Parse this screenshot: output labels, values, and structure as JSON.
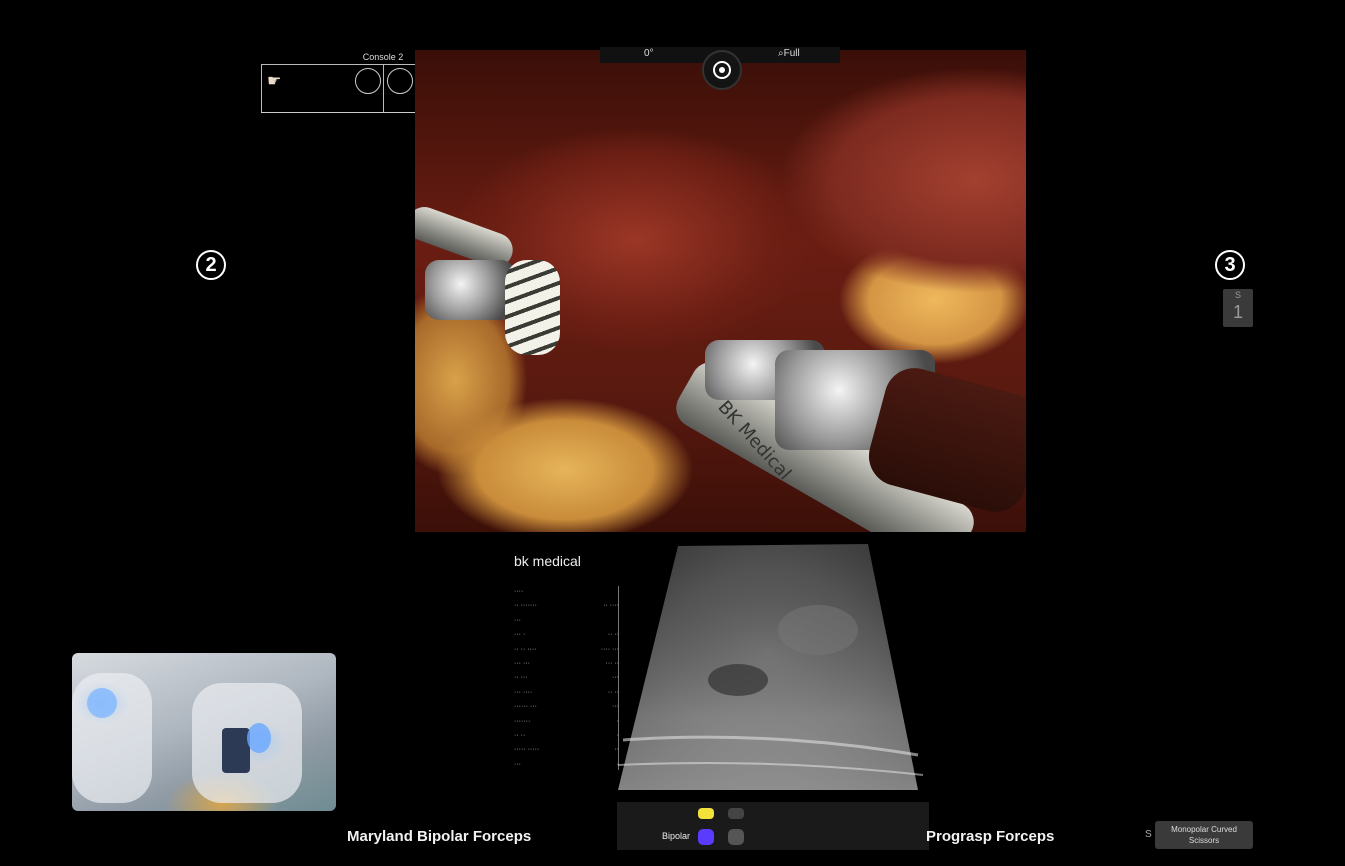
{
  "console": {
    "title": "Console 2"
  },
  "status_bar": {
    "left_value": "0°",
    "right_value": "Full"
  },
  "arms": {
    "left_number": "2",
    "right_number": "3",
    "right_badge_label": "S",
    "right_badge_number": "1"
  },
  "ultrasound": {
    "brand": "bk medical",
    "bipolar_label": "Bipolar"
  },
  "instruments": {
    "left": "Maryland Bipolar Forceps",
    "right": "Prograsp Forceps",
    "arm3": "Monopolar Curved Scissors",
    "arm3_prefix": "S"
  },
  "probe": {
    "label": "BK Medical"
  },
  "colors": {
    "background": "#000000",
    "bipolar_pedal": "#5a3cff",
    "yellow_pedal": "#f2e23a"
  }
}
